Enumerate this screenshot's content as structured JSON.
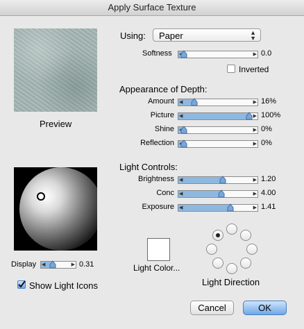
{
  "window": {
    "title": "Apply Surface Texture"
  },
  "preview": {
    "label": "Preview"
  },
  "using": {
    "label": "Using:",
    "value": "Paper",
    "softness_label": "Softness",
    "softness_value": "0.0",
    "softness_level": 0.0,
    "inverted_label": "Inverted",
    "inverted_checked": false
  },
  "depth": {
    "title": "Appearance of Depth:",
    "sliders": [
      {
        "label": "Amount",
        "value": "16%",
        "level": 0.16
      },
      {
        "label": "Picture",
        "value": "100%",
        "level": 1.0
      },
      {
        "label": "Shine",
        "value": "0%",
        "level": 0.0
      },
      {
        "label": "Reflection",
        "value": "0%",
        "level": 0.0
      }
    ]
  },
  "light": {
    "title": "Light Controls:",
    "sliders": [
      {
        "label": "Brightness",
        "value": "1.20",
        "level": 0.6
      },
      {
        "label": "Conc",
        "value": "4.00",
        "level": 0.57
      },
      {
        "label": "Exposure",
        "value": "1.41",
        "level": 0.71
      }
    ],
    "color_label": "Light Color...",
    "direction_label": "Light Direction",
    "direction_selected": 0
  },
  "display": {
    "label": "Display",
    "value": "0.31",
    "level": 0.31,
    "show_icons_label": "Show Light Icons",
    "show_icons_checked": true
  },
  "buttons": {
    "cancel": "Cancel",
    "ok": "OK"
  },
  "colors": {
    "slider_fill": "#8fb8e0",
    "ok_button": "#6fa7e8"
  }
}
